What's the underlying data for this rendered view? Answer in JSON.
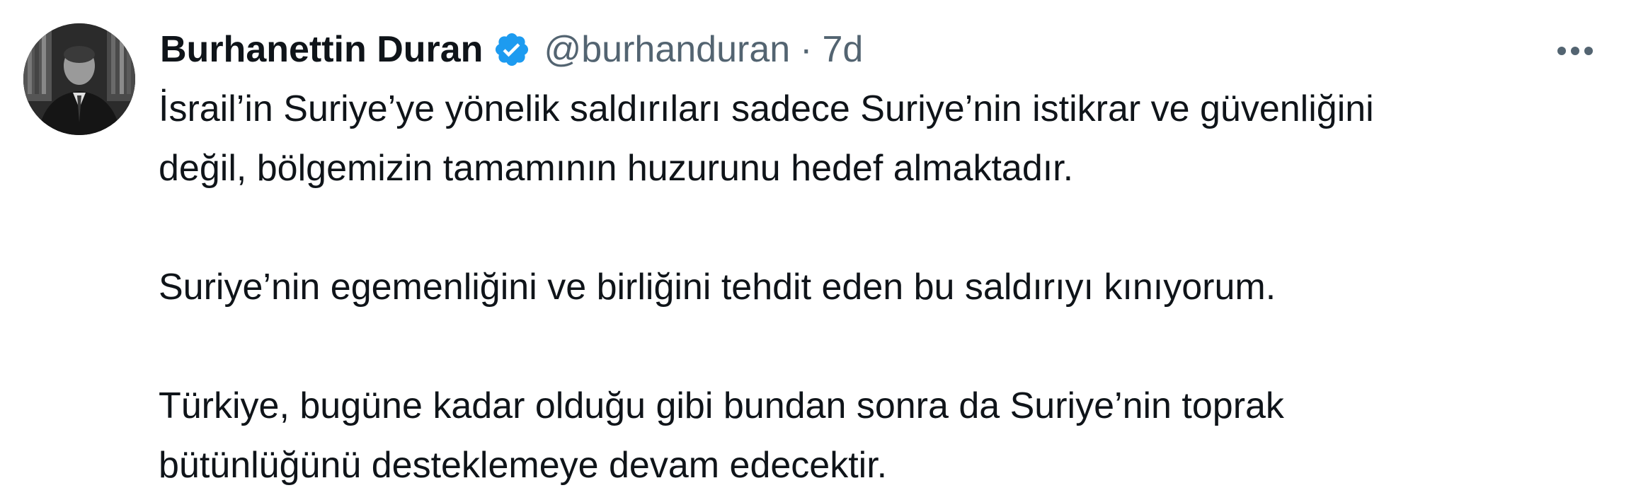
{
  "tweet": {
    "author": {
      "display_name": "Burhanettin Duran",
      "handle": "@burhanduran",
      "verified": true,
      "verified_icon": "verified-badge-icon",
      "verified_color": "#1d9bf0"
    },
    "separator": "·",
    "time": "7d",
    "more_icon": "more-horizontal-icon",
    "body": {
      "p1_line1": "İsrail’in Suriye’ye yönelik saldırıları sadece Suriye’nin istikrar ve güvenliğini",
      "p1_line2": "değil, bölgemizin tamamının huzurunu hedef almaktadır.",
      "p2_line1": "Suriye’nin egemenliğini ve birliğini tehdit eden bu saldırıyı kınıyorum.",
      "p3_line1": "Türkiye, bugüne kadar olduğu gibi bundan sonra da Suriye’nin toprak",
      "p3_line2": "bütünlüğünü desteklemeye devam edecektir."
    }
  },
  "colors": {
    "text_primary": "#0f1419",
    "text_secondary": "#536471",
    "background": "#ffffff"
  }
}
